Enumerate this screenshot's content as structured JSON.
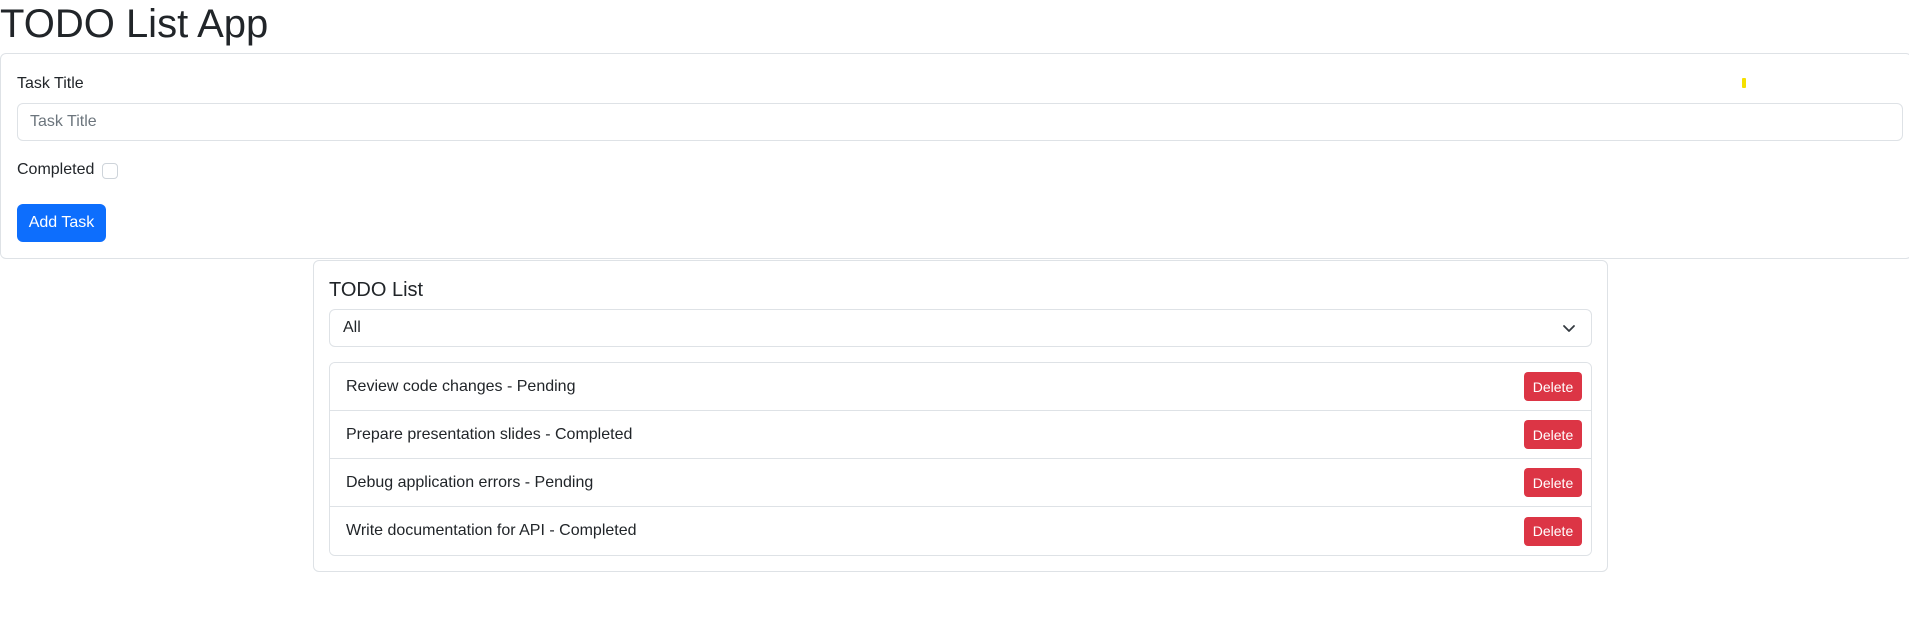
{
  "app": {
    "title": "TODO List App"
  },
  "form": {
    "title_label": "Task Title",
    "title_placeholder": "Task Title",
    "title_value": "",
    "completed_label": "Completed",
    "completed_checked": false,
    "add_button_label": "Add Task"
  },
  "list": {
    "title": "TODO List",
    "filter": {
      "selected": "All"
    },
    "delete_label": "Delete",
    "tasks": [
      {
        "text": "Review code changes - Pending"
      },
      {
        "text": "Prepare presentation slides - Completed"
      },
      {
        "text": "Debug application errors - Pending"
      },
      {
        "text": "Write documentation for API - Completed"
      }
    ]
  },
  "colors": {
    "primary": "#0d6efd",
    "danger": "#dc3545",
    "border": "#dee2e6",
    "marker_yellow": "#f5e000"
  },
  "icons": {
    "filter_dropdown": "chevron-down-icon"
  }
}
